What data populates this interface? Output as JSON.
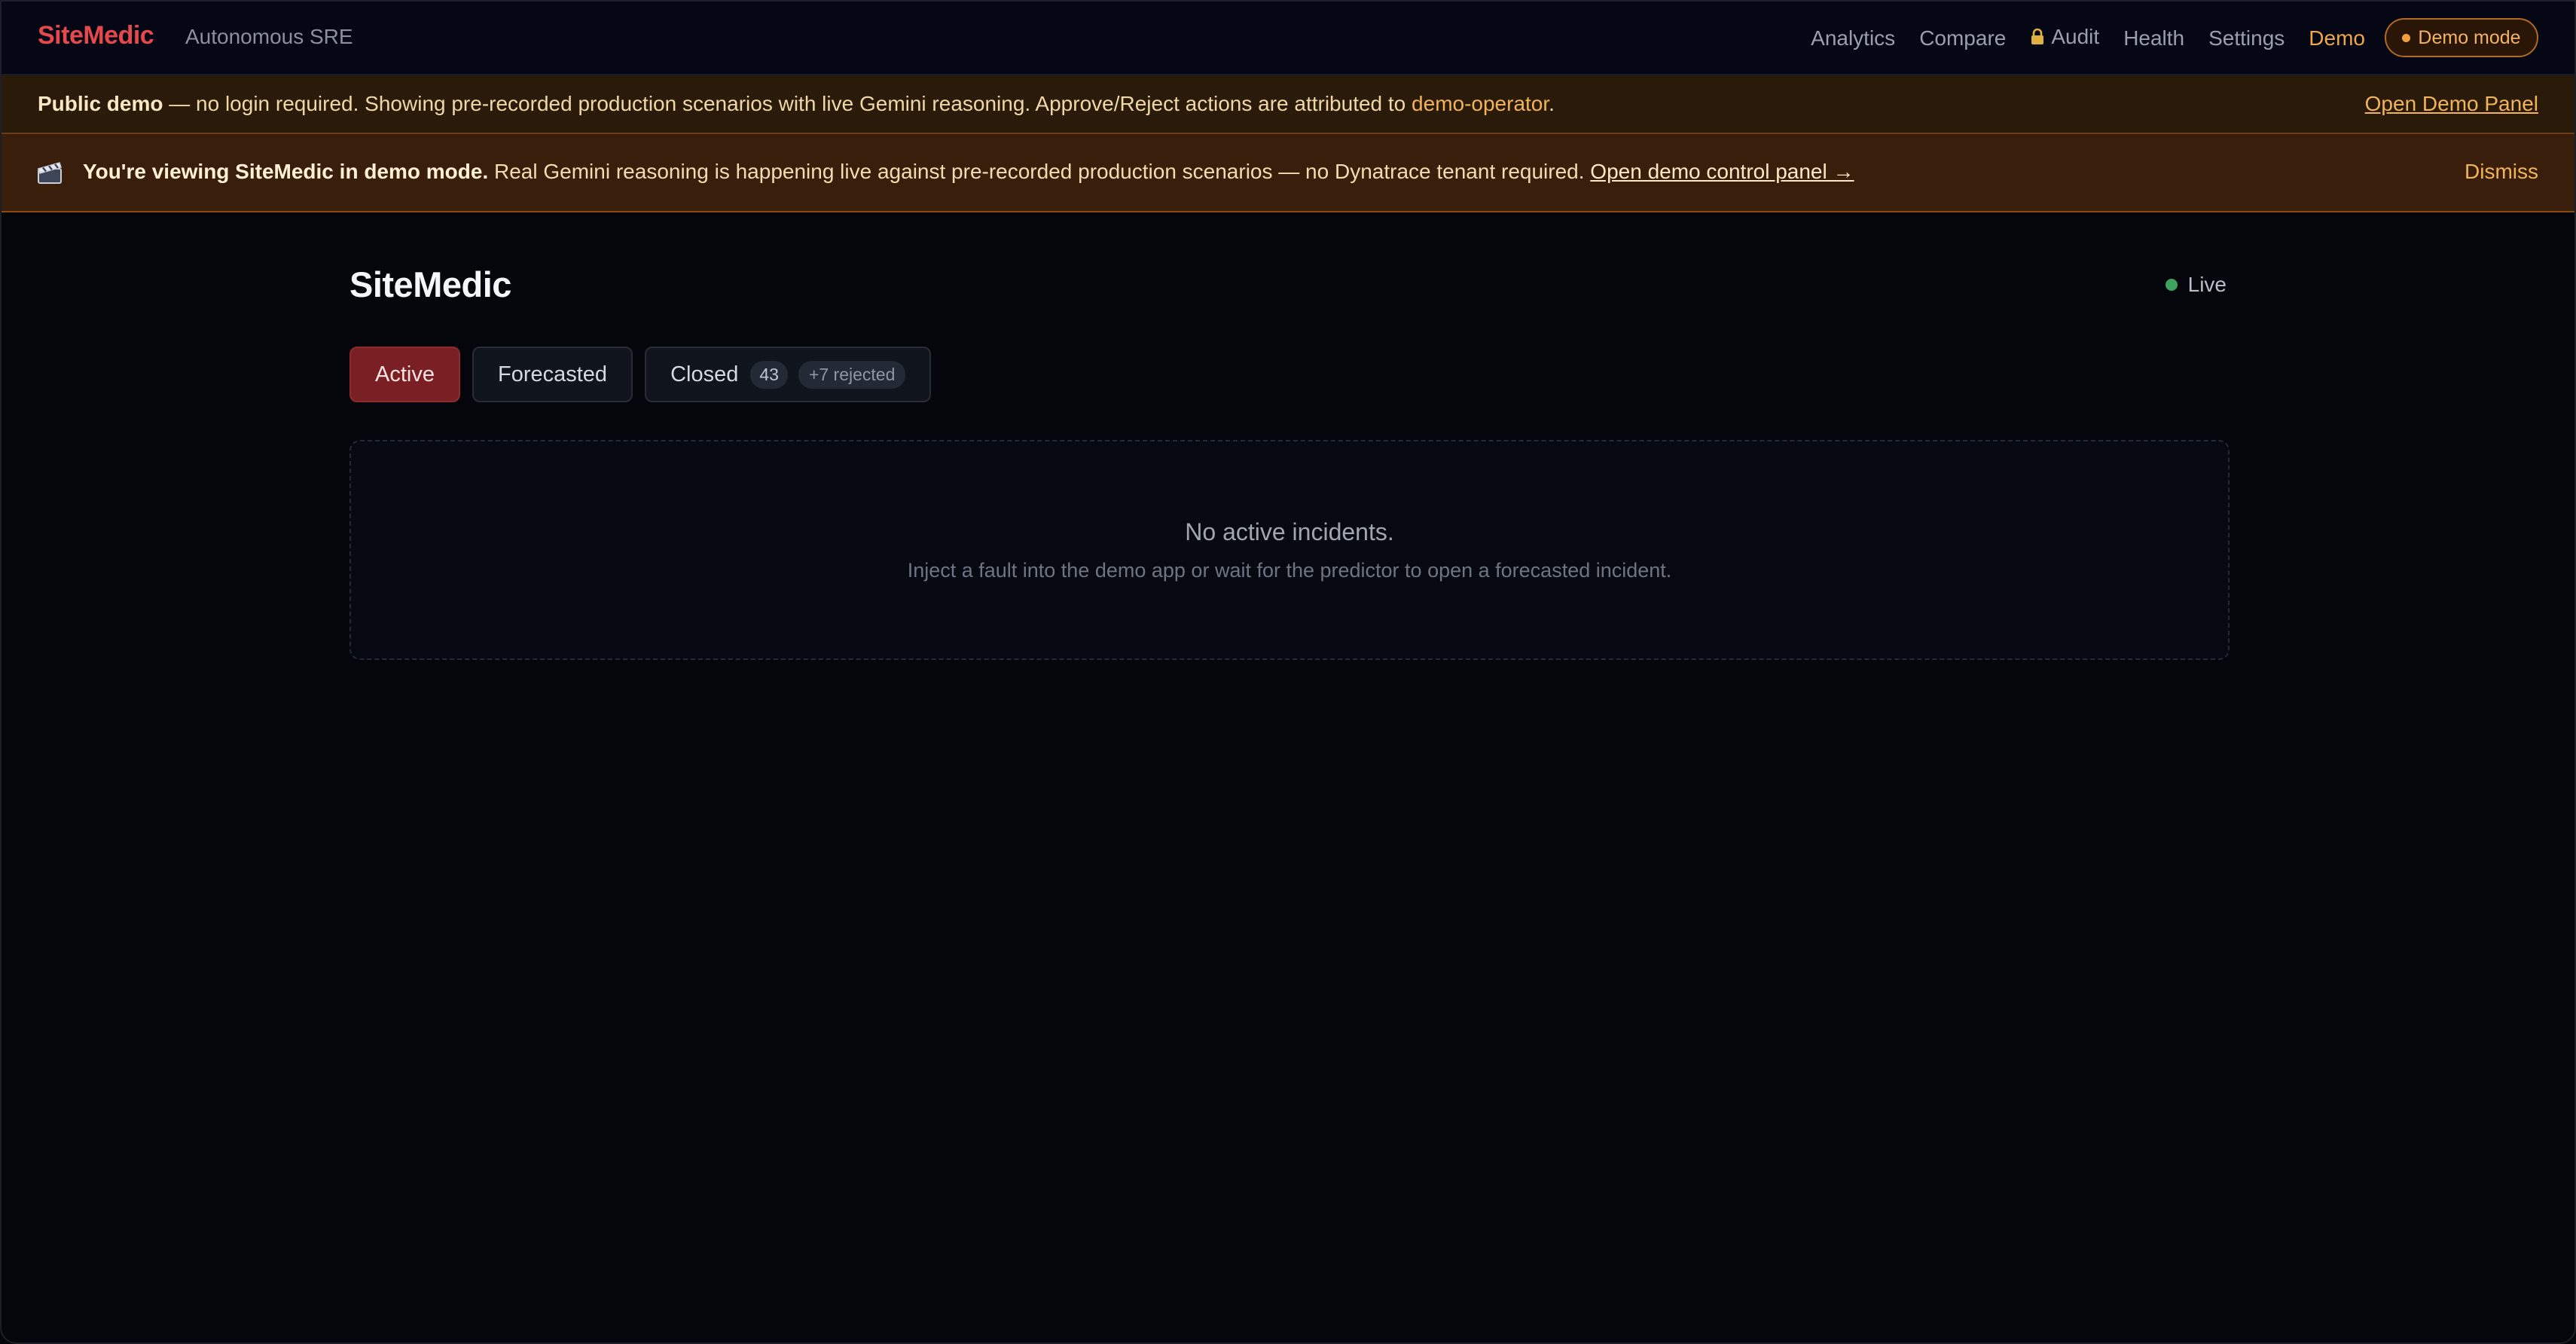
{
  "nav": {
    "brand": "SiteMedic",
    "subtitle": "Autonomous SRE",
    "links": [
      "Analytics",
      "Compare",
      "Audit",
      "Health",
      "Settings"
    ],
    "demo_link": "Demo",
    "demo_badge": "Demo mode"
  },
  "banner_public": {
    "bold": "Public demo",
    "text": " — no login required. Showing pre-recorded production scenarios with live Gemini reasoning. Approve/Reject actions are attributed to ",
    "operator": "demo-operator",
    "end": ".",
    "link": "Open Demo Panel"
  },
  "banner_demo": {
    "bold": "You're viewing SiteMedic in demo mode.",
    "text": " Real Gemini reasoning is happening live against pre-recorded production scenarios — no Dynatrace tenant required. ",
    "link": "Open demo control panel →",
    "dismiss": "Dismiss"
  },
  "main": {
    "title": "SiteMedic",
    "status": "Live",
    "tabs": {
      "active": "Active",
      "forecasted": "Forecasted",
      "closed": "Closed",
      "closed_count": "43",
      "rejected": "+7 rejected"
    },
    "empty": {
      "title": "No active incidents.",
      "subtitle": "Inject a fault into the demo app or wait for the predictor to open a forecasted incident."
    }
  },
  "colors": {
    "brand": "#e5484d",
    "accent": "#f0a64a",
    "live": "#3fa360",
    "active_tab": "#7a1f23"
  }
}
